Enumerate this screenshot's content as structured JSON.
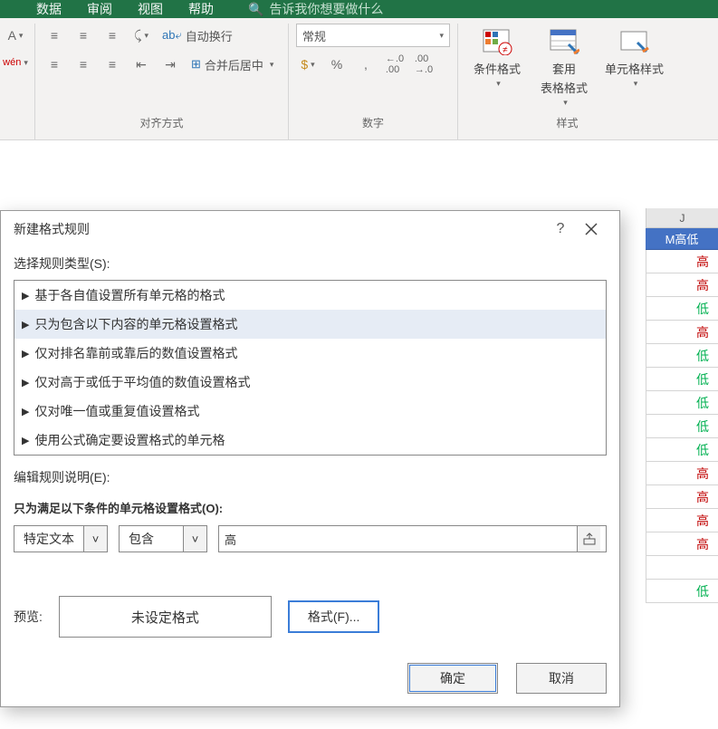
{
  "ribbon": {
    "tabs": [
      "数据",
      "审阅",
      "视图",
      "帮助"
    ],
    "tellme_placeholder": "告诉我你想要做什么",
    "wrap_text": "自动换行",
    "merge_center": "合并后居中",
    "number_format": "常规",
    "percent": "%",
    "comma": ",",
    "inc_dec": ".0",
    "cond_fmt": "条件格式",
    "table_fmt_l1": "套用",
    "table_fmt_l2": "表格格式",
    "cell_style": "单元格样式",
    "group_align": "对齐方式",
    "group_number": "数字",
    "group_style": "样式"
  },
  "sheet": {
    "column_letter": "J",
    "column_header": "M高低",
    "cells": [
      "高",
      "高",
      "低",
      "高",
      "低",
      "低",
      "低",
      "低",
      "低",
      "高",
      "高",
      "高",
      "高",
      "",
      "低"
    ],
    "classes": [
      "red",
      "red",
      "green",
      "red",
      "green",
      "green",
      "green",
      "green",
      "green",
      "red",
      "red",
      "red",
      "red",
      "",
      "green"
    ]
  },
  "dialog": {
    "title": "新建格式规则",
    "select_label": "选择规则类型(S):",
    "rules": [
      "基于各自值设置所有单元格的格式",
      "只为包含以下内容的单元格设置格式",
      "仅对排名靠前或靠后的数值设置格式",
      "仅对高于或低于平均值的数值设置格式",
      "仅对唯一值或重复值设置格式",
      "使用公式确定要设置格式的单元格"
    ],
    "selected_index": 1,
    "edit_label": "编辑规则说明(E):",
    "condition_label": "只为满足以下条件的单元格设置格式(O):",
    "combo1": "特定文本",
    "combo2": "包含",
    "textbox_value": "高",
    "preview_label": "预览:",
    "preview_text": "未设定格式",
    "format_btn": "格式(F)...",
    "ok": "确定",
    "cancel": "取消"
  }
}
